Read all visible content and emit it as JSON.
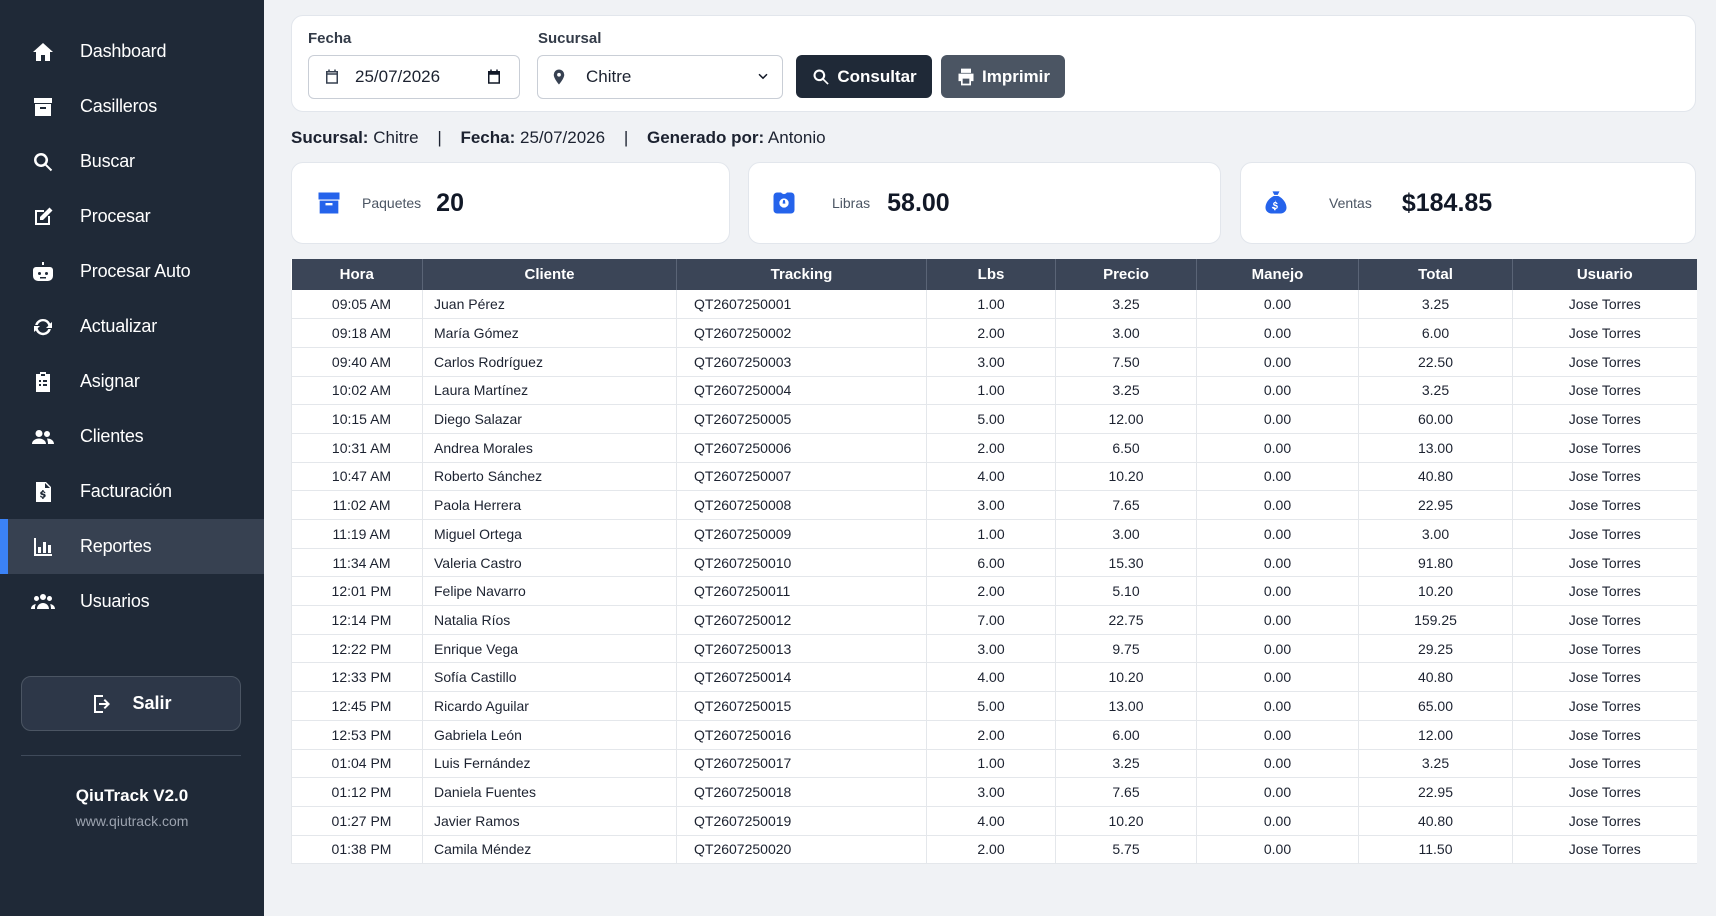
{
  "sidebar": {
    "items": [
      {
        "label": "Dashboard",
        "icon": "home-icon"
      },
      {
        "label": "Casilleros",
        "icon": "archive-icon"
      },
      {
        "label": "Buscar",
        "icon": "search-icon"
      },
      {
        "label": "Procesar",
        "icon": "edit-icon"
      },
      {
        "label": "Procesar Auto",
        "icon": "robot-icon"
      },
      {
        "label": "Actualizar",
        "icon": "refresh-icon"
      },
      {
        "label": "Asignar",
        "icon": "clipboard-icon"
      },
      {
        "label": "Clientes",
        "icon": "users-icon"
      },
      {
        "label": "Facturación",
        "icon": "invoice-icon"
      },
      {
        "label": "Reportes",
        "icon": "chart-bar-icon",
        "active": true
      },
      {
        "label": "Usuarios",
        "icon": "users-group-icon"
      }
    ],
    "logout_label": "Salir",
    "brand": "QiuTrack V2.0",
    "url": "www.qiutrack.com"
  },
  "filters": {
    "fecha_label": "Fecha",
    "fecha_value": "25/07/2026",
    "sucursal_label": "Sucursal",
    "sucursal_value": "Chitre",
    "consultar_label": "Consultar",
    "imprimir_label": "Imprimir"
  },
  "info": {
    "sucursal_label": "Sucursal:",
    "sucursal_value": "Chitre",
    "fecha_label": "Fecha:",
    "fecha_value": "25/07/2026",
    "generado_label": "Generado por:",
    "generado_value": "Antonio"
  },
  "cards": {
    "paquetes_label": "Paquetes",
    "paquetes_value": "20",
    "libras_label": "Libras",
    "libras_value": "58.00",
    "ventas_label": "Ventas",
    "ventas_value": "$184.85"
  },
  "table": {
    "headers": [
      "Hora",
      "Cliente",
      "Tracking",
      "Lbs",
      "Precio",
      "Manejo",
      "Total",
      "Usuario"
    ],
    "rows": [
      [
        "09:05 AM",
        "Juan Pérez",
        "QT2607250001",
        "1.00",
        "3.25",
        "0.00",
        "3.25",
        "Jose Torres"
      ],
      [
        "09:18 AM",
        "María Gómez",
        "QT2607250002",
        "2.00",
        "3.00",
        "0.00",
        "6.00",
        "Jose Torres"
      ],
      [
        "09:40 AM",
        "Carlos Rodríguez",
        "QT2607250003",
        "3.00",
        "7.50",
        "0.00",
        "22.50",
        "Jose Torres"
      ],
      [
        "10:02 AM",
        "Laura Martínez",
        "QT2607250004",
        "1.00",
        "3.25",
        "0.00",
        "3.25",
        "Jose Torres"
      ],
      [
        "10:15 AM",
        "Diego Salazar",
        "QT2607250005",
        "5.00",
        "12.00",
        "0.00",
        "60.00",
        "Jose Torres"
      ],
      [
        "10:31 AM",
        "Andrea Morales",
        "QT2607250006",
        "2.00",
        "6.50",
        "0.00",
        "13.00",
        "Jose Torres"
      ],
      [
        "10:47 AM",
        "Roberto Sánchez",
        "QT2607250007",
        "4.00",
        "10.20",
        "0.00",
        "40.80",
        "Jose Torres"
      ],
      [
        "11:02 AM",
        "Paola Herrera",
        "QT2607250008",
        "3.00",
        "7.65",
        "0.00",
        "22.95",
        "Jose Torres"
      ],
      [
        "11:19 AM",
        "Miguel Ortega",
        "QT2607250009",
        "1.00",
        "3.00",
        "0.00",
        "3.00",
        "Jose Torres"
      ],
      [
        "11:34 AM",
        "Valeria Castro",
        "QT2607250010",
        "6.00",
        "15.30",
        "0.00",
        "91.80",
        "Jose Torres"
      ],
      [
        "12:01 PM",
        "Felipe Navarro",
        "QT2607250011",
        "2.00",
        "5.10",
        "0.00",
        "10.20",
        "Jose Torres"
      ],
      [
        "12:14 PM",
        "Natalia Ríos",
        "QT2607250012",
        "7.00",
        "22.75",
        "0.00",
        "159.25",
        "Jose Torres"
      ],
      [
        "12:22 PM",
        "Enrique Vega",
        "QT2607250013",
        "3.00",
        "9.75",
        "0.00",
        "29.25",
        "Jose Torres"
      ],
      [
        "12:33 PM",
        "Sofía Castillo",
        "QT2607250014",
        "4.00",
        "10.20",
        "0.00",
        "40.80",
        "Jose Torres"
      ],
      [
        "12:45 PM",
        "Ricardo Aguilar",
        "QT2607250015",
        "5.00",
        "13.00",
        "0.00",
        "65.00",
        "Jose Torres"
      ],
      [
        "12:53 PM",
        "Gabriela León",
        "QT2607250016",
        "2.00",
        "6.00",
        "0.00",
        "12.00",
        "Jose Torres"
      ],
      [
        "01:04 PM",
        "Luis Fernández",
        "QT2607250017",
        "1.00",
        "3.25",
        "0.00",
        "3.25",
        "Jose Torres"
      ],
      [
        "01:12 PM",
        "Daniela Fuentes",
        "QT2607250018",
        "3.00",
        "7.65",
        "0.00",
        "22.95",
        "Jose Torres"
      ],
      [
        "01:27 PM",
        "Javier Ramos",
        "QT2607250019",
        "4.00",
        "10.20",
        "0.00",
        "40.80",
        "Jose Torres"
      ],
      [
        "01:38 PM",
        "Camila Méndez",
        "QT2607250020",
        "2.00",
        "5.75",
        "0.00",
        "11.50",
        "Jose Torres"
      ]
    ]
  },
  "colors": {
    "sidebar_bg": "#1f2937",
    "accent": "#3b82f6",
    "consultar_bg": "#1f2937",
    "imprimir_bg": "#4b5563",
    "table_header_bg": "#3b4557",
    "card_icon": "#2563eb"
  }
}
